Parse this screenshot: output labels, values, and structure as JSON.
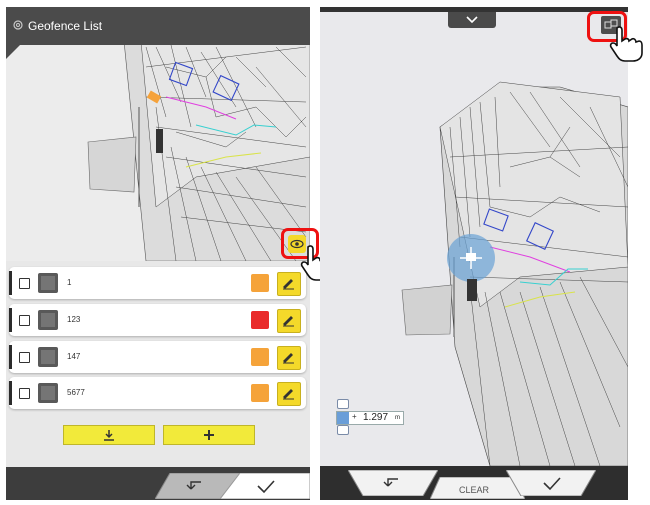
{
  "left_panel": {
    "title": "Geofence List",
    "icons": {
      "settings": "gear-icon",
      "visibility": "eye-icon"
    },
    "rows": [
      {
        "name": "1",
        "color": "#f5a33a"
      },
      {
        "name": "123",
        "color": "#e92a2a"
      },
      {
        "name": "147",
        "color": "#f5a33a"
      },
      {
        "name": "5677",
        "color": "#f5a33a"
      }
    ],
    "buttons": {
      "import": "download-icon",
      "add": "plus-icon",
      "back": "return-icon",
      "confirm": "check-icon"
    }
  },
  "right_panel": {
    "scale": {
      "sign": "+",
      "value": "1.297",
      "unit": "m"
    },
    "footer": {
      "clear_label": "CLEAR"
    },
    "icons": {
      "view_switch": "view-switch-icon",
      "collapse": "chevron-down-icon"
    }
  },
  "colors": {
    "accent_yellow": "#f4d92a",
    "highlight_red": "#e11111",
    "dark": "#3d3d3d"
  }
}
